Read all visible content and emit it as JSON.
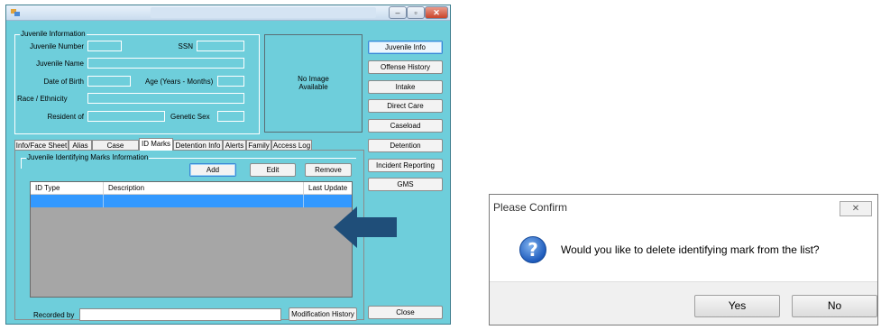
{
  "window": {
    "title": "",
    "buttons": {
      "minimize": "–",
      "maximize": "▫",
      "close": "✕"
    }
  },
  "juvenile_info": {
    "legend": "Juvenile Information",
    "labels": {
      "number": "Juvenile Number",
      "ssn": "SSN",
      "name": "Juvenile Name",
      "dob": "Date of Birth",
      "age": "Age (Years - Months)",
      "race": "Race / Ethnicity",
      "resident": "Resident of",
      "sex": "Genetic Sex"
    },
    "values": {
      "number": "",
      "ssn": "",
      "name": "",
      "dob": "",
      "age": "",
      "race": "",
      "resident": "",
      "sex": ""
    },
    "photo_text": "No Image\nAvailable"
  },
  "side_buttons": [
    "Juvenile Info",
    "Offense History",
    "Intake",
    "Direct Care",
    "Caseload",
    "Detention",
    "Incident Reporting",
    "GMS"
  ],
  "close_button": "Close",
  "tabs": [
    "Info/Face Sheet",
    "Alias",
    "Case Workers",
    "ID Marks",
    "Detention Info",
    "Alerts",
    "Family",
    "Access Log"
  ],
  "id_marks": {
    "legend": "Juvenile Identifying Marks Information",
    "add": "Add",
    "edit": "Edit",
    "remove": "Remove",
    "columns": [
      "ID Type",
      "Description",
      "Last Update"
    ],
    "rows": [
      {
        "id_type": "",
        "description": "",
        "last_update": "",
        "selected": true
      }
    ],
    "recorded_by_label": "Recorded by",
    "recorded_by_value": "",
    "modification_history": "Modification History"
  },
  "dialog": {
    "title": "Please Confirm",
    "close": "✕",
    "message": "Would you like to delete identifying mark from the list?",
    "yes": "Yes",
    "no": "No",
    "icon": "question-icon"
  },
  "colors": {
    "form_background": "#6ecedb",
    "selection": "#3399ff",
    "arrow": "#1f4e79",
    "grid_empty": "#a6a6a6"
  }
}
